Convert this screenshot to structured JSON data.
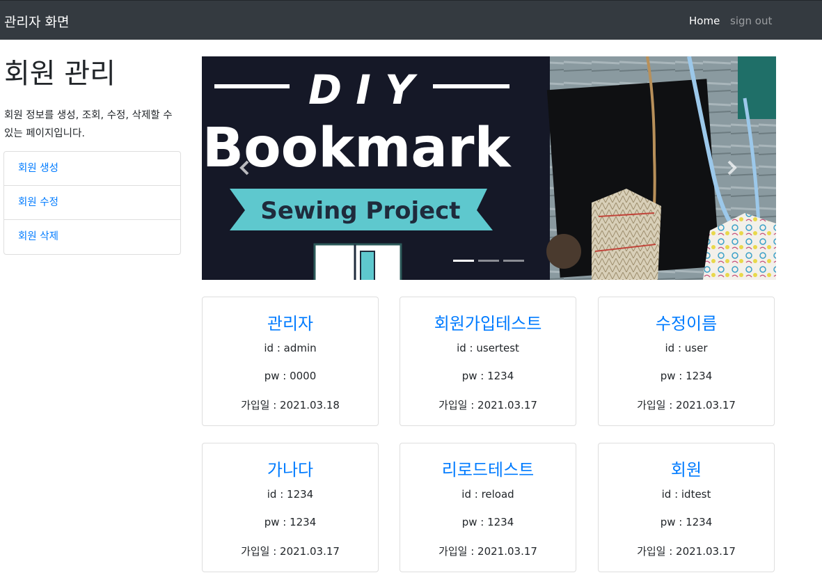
{
  "navbar": {
    "brand": "관리자 화면",
    "links": [
      {
        "label": "Home",
        "active": true
      },
      {
        "label": "sign out",
        "active": false
      }
    ]
  },
  "sidebar": {
    "heading": "회원 관리",
    "description": "회원 정보를 생성, 조회, 수정, 삭제할 수 있는 페이지입니다.",
    "items": [
      {
        "label": "회원 생성"
      },
      {
        "label": "회원 수정"
      },
      {
        "label": "회원 삭제"
      }
    ]
  },
  "carousel": {
    "slide_title_line1": "D I Y",
    "slide_title_line2": "Bookmark",
    "slide_subtitle": "Sewing Project",
    "indicator_count": 3,
    "active_indicator": 0,
    "colors": {
      "dark_bg": "#151827",
      "ribbon": "#5ec8ce",
      "subtitle": "#1f2b3c"
    }
  },
  "members": [
    {
      "name": "관리자",
      "id_line": "id : admin",
      "pw_line": "pw : 0000",
      "date_line": "가입일 : 2021.03.18"
    },
    {
      "name": "회원가입테스트",
      "id_line": "id : usertest",
      "pw_line": "pw : 1234",
      "date_line": "가입일 : 2021.03.17"
    },
    {
      "name": "수정이름",
      "id_line": "id : user",
      "pw_line": "pw : 1234",
      "date_line": "가입일 : 2021.03.17"
    },
    {
      "name": "가나다",
      "id_line": "id : 1234",
      "pw_line": "pw : 1234",
      "date_line": "가입일 : 2021.03.17"
    },
    {
      "name": "리로드테스트",
      "id_line": "id : reload",
      "pw_line": "pw : 1234",
      "date_line": "가입일 : 2021.03.17"
    },
    {
      "name": "회원",
      "id_line": "id : idtest",
      "pw_line": "pw : 1234",
      "date_line": "가입일 : 2021.03.17"
    }
  ],
  "colors": {
    "navbar": "#343a40",
    "link": "#007bff",
    "text": "#212529"
  }
}
